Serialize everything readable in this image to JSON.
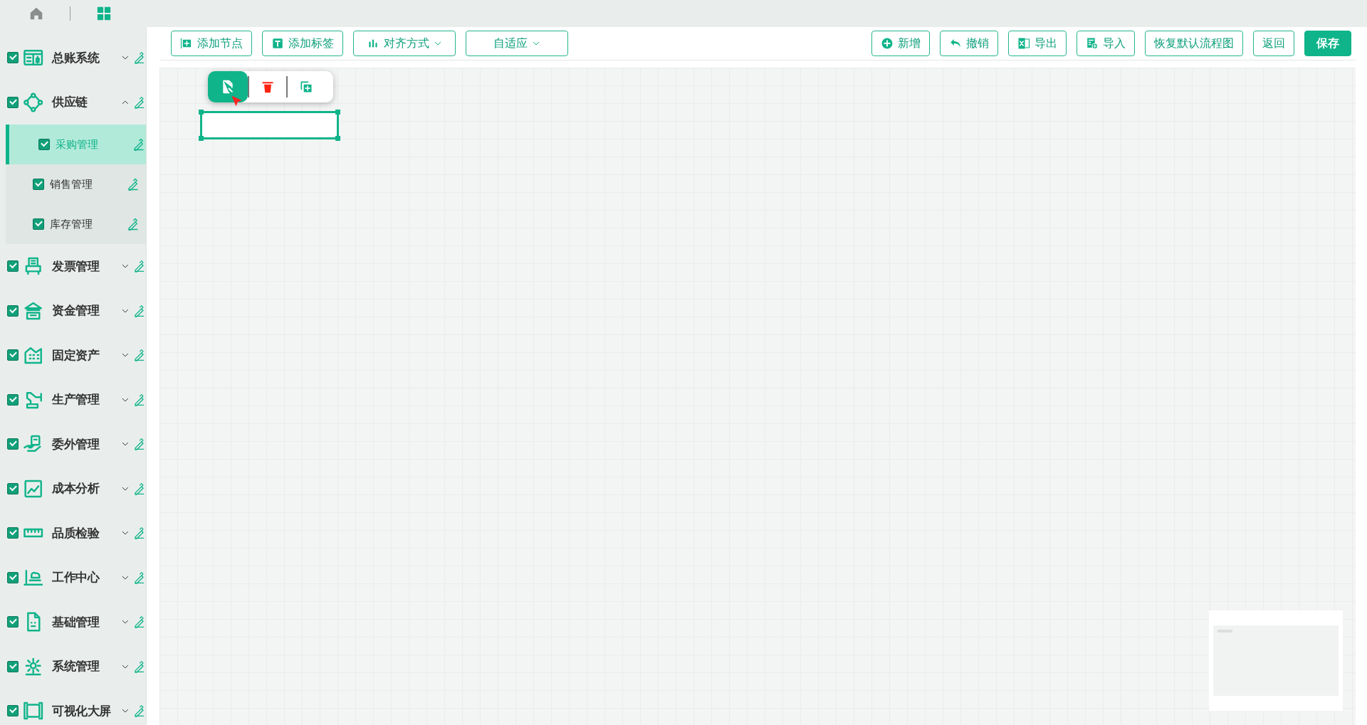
{
  "top_bar": {
    "tabs": [
      {
        "selected": false
      },
      {
        "selected": true
      }
    ]
  },
  "sidebar": {
    "items": [
      {
        "label": "总账系统",
        "checked": true,
        "expanded": false
      },
      {
        "label": "供应链",
        "checked": true,
        "expanded": true,
        "children": [
          {
            "label": "采购管理",
            "checked": true,
            "selected": true
          },
          {
            "label": "销售管理",
            "checked": true,
            "selected": false
          },
          {
            "label": "库存管理",
            "checked": true,
            "selected": false
          }
        ]
      },
      {
        "label": "发票管理",
        "checked": true,
        "expanded": false
      },
      {
        "label": "资金管理",
        "checked": true,
        "expanded": false
      },
      {
        "label": "固定资产",
        "checked": true,
        "expanded": false
      },
      {
        "label": "生产管理",
        "checked": true,
        "expanded": false
      },
      {
        "label": "委外管理",
        "checked": true,
        "expanded": false
      },
      {
        "label": "成本分析",
        "checked": true,
        "expanded": false
      },
      {
        "label": "品质检验",
        "checked": true,
        "expanded": false
      },
      {
        "label": "工作中心",
        "checked": true,
        "expanded": false
      },
      {
        "label": "基础管理",
        "checked": true,
        "expanded": false
      },
      {
        "label": "系统管理",
        "checked": true,
        "expanded": false
      },
      {
        "label": "可视化大屏",
        "checked": true,
        "expanded": false
      }
    ]
  },
  "toolbar": {
    "left": [
      {
        "label": "添加节点",
        "kind": "button"
      },
      {
        "label": "添加标签",
        "kind": "button"
      },
      {
        "label": "对齐方式",
        "kind": "dropdown"
      },
      {
        "label": "自适应",
        "kind": "dropdown"
      }
    ],
    "right": [
      {
        "label": "新增",
        "kind": "button"
      },
      {
        "label": "撤销",
        "kind": "button"
      },
      {
        "label": "导出",
        "kind": "button"
      },
      {
        "label": "导入",
        "kind": "button"
      },
      {
        "label": "恢复默认流程图",
        "kind": "button"
      },
      {
        "label": "返回",
        "kind": "button"
      },
      {
        "label": "保存",
        "kind": "primary"
      }
    ]
  },
  "canvas": {
    "node_tools": [
      {
        "selected": true
      },
      {
        "selected": false
      },
      {
        "selected": false
      }
    ],
    "node": {
      "selected": true
    }
  }
}
